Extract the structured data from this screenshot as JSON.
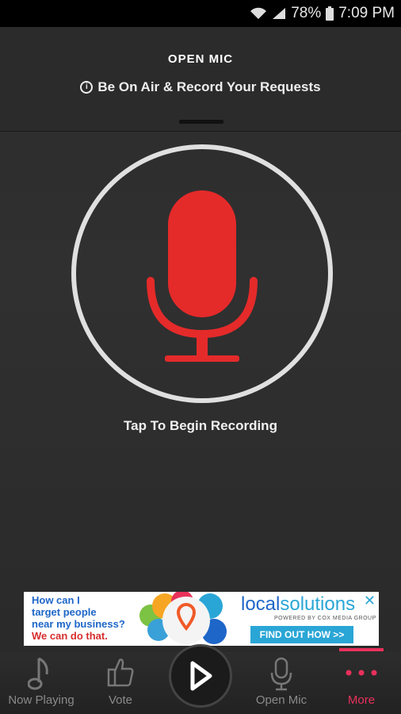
{
  "status_bar": {
    "battery": "78%",
    "time": "7:09 PM"
  },
  "header": {
    "title": "OPEN MIC",
    "subtitle": "Be On Air & Record Your Requests"
  },
  "recorder": {
    "prompt": "Tap To Begin Recording"
  },
  "ad": {
    "line1": "How can I",
    "line2": "target people",
    "line3": "near my business?",
    "line4": "We can do that.",
    "brand_local": "local",
    "brand_solutions": "solutions",
    "brand_sub": "POWERED BY COX MEDIA GROUP",
    "cta": "FIND OUT HOW >>"
  },
  "bottom_nav": {
    "items": [
      {
        "label": "Now Playing"
      },
      {
        "label": "Vote"
      },
      {
        "label": "Open Mic"
      },
      {
        "label": "More"
      }
    ]
  },
  "colors": {
    "accent": "#e8315b",
    "mic_red": "#e52a2a"
  }
}
